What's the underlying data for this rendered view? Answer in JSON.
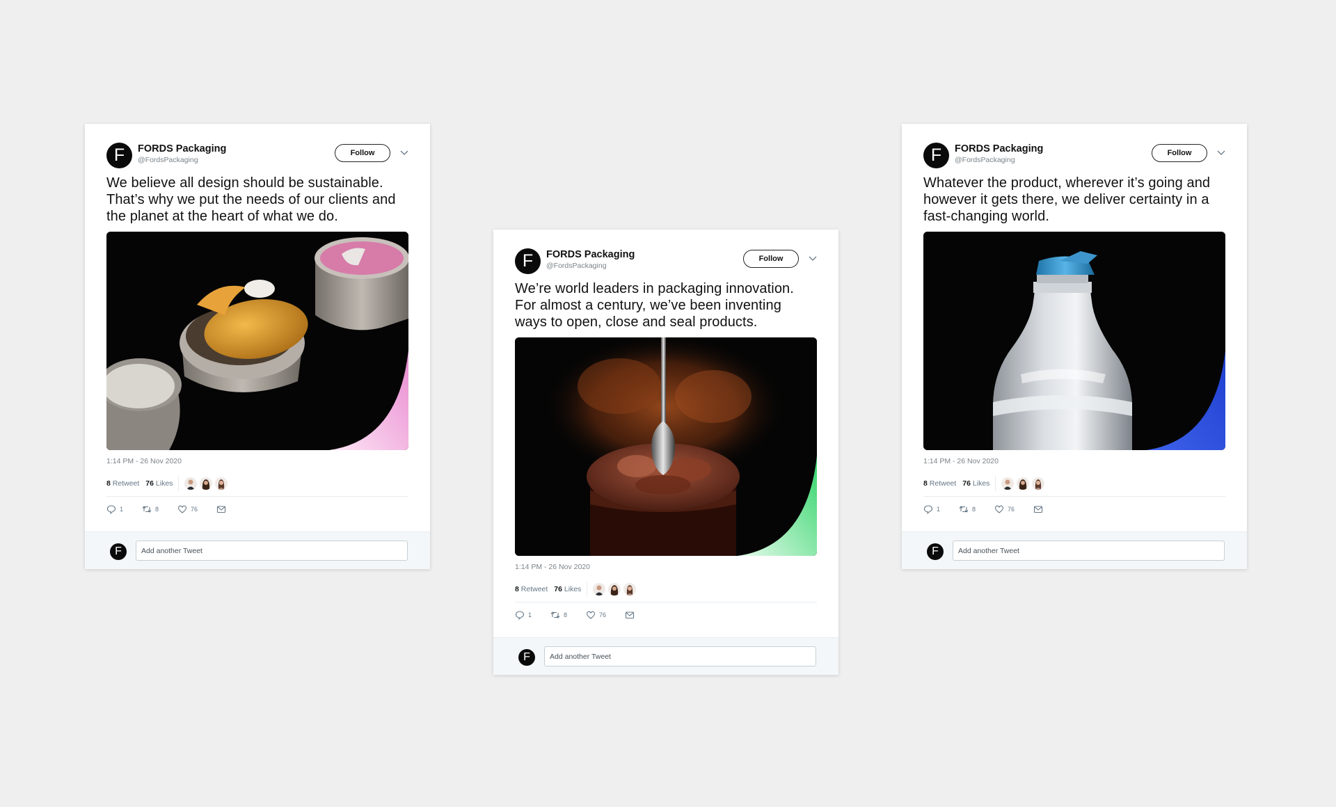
{
  "tweets": [
    {
      "name": "FORDS Packaging",
      "handle": "@FordsPackaging",
      "avatar_letter": "F",
      "follow_label": "Follow",
      "text": "We believe all design should be sustainable. That’s why we put the needs of our clients and the planet at the heart of what we do.",
      "media": "sealed-jars-product-photo",
      "accent_color": "#f29ad8",
      "timestamp": "1:14 PM - 26 Nov 2020",
      "retweet_count": "8",
      "retweet_label": "Retweet",
      "likes_count": "76",
      "likes_label": "Likes",
      "reply_count": "1",
      "retweet_action_count": "8",
      "like_action_count": "76",
      "reply_placeholder": "Add another Tweet"
    },
    {
      "name": "FORDS Packaging",
      "handle": "@FordsPackaging",
      "avatar_letter": "F",
      "follow_label": "Follow",
      "text": "We’re world leaders in packaging innovation. For almost a century, we’ve been inventing ways to open, close and seal products.",
      "media": "chocolate-dessert-spoon-photo",
      "accent_color": "#3fdc74",
      "timestamp": "1:14 PM - 26 Nov 2020",
      "retweet_count": "8",
      "retweet_label": "Retweet",
      "likes_count": "76",
      "likes_label": "Likes",
      "reply_count": "1",
      "retweet_action_count": "8",
      "like_action_count": "76",
      "reply_placeholder": "Add another Tweet"
    },
    {
      "name": "FORDS Packaging",
      "handle": "@FordsPackaging",
      "avatar_letter": "F",
      "follow_label": "Follow",
      "text": "Whatever the product, wherever it’s going and however it gets there, we deliver certainty in a fast-changing world.",
      "media": "water-bottle-photo",
      "accent_color": "#2d55e0",
      "timestamp": "1:14 PM - 26 Nov 2020",
      "retweet_count": "8",
      "retweet_label": "Retweet",
      "likes_count": "76",
      "likes_label": "Likes",
      "reply_count": "1",
      "retweet_action_count": "8",
      "like_action_count": "76",
      "reply_placeholder": "Add another Tweet"
    }
  ]
}
